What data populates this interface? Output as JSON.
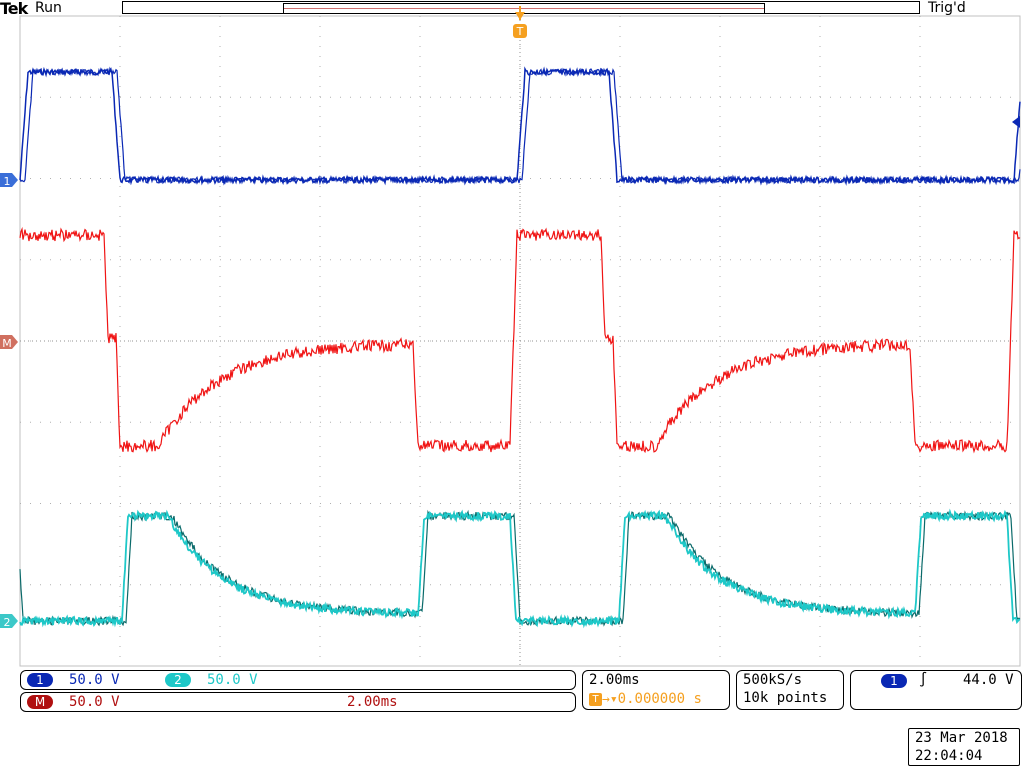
{
  "header": {
    "brand": "Tek",
    "run_state": "Run",
    "trigger_status": "Trig'd"
  },
  "markers": {
    "ch1": "1",
    "math": "M",
    "ch2": "2",
    "trigger_position": "T"
  },
  "colors": {
    "ch1": "#0a28b4",
    "math": "#f01414",
    "ch2": "#1ec8c8",
    "ch2_dark": "#0a6a6a",
    "trigger": "#f5a020",
    "math_badge": "#b01010",
    "grid": "#b0b0b0"
  },
  "channel_readout": {
    "ch1_badge": "1",
    "ch1_scale": "50.0 V",
    "ch2_badge": "2",
    "ch2_scale": "50.0 V",
    "math_badge": "M",
    "math_scale": "50.0 V",
    "math_timebase": "2.00ms"
  },
  "horizontal": {
    "timebase": "2.00ms",
    "trigger_icon": "T",
    "delay_arrow": "→▾",
    "delay": "0.000000 s"
  },
  "acquisition": {
    "sample_rate": "500kS/s",
    "record_length": "10k points"
  },
  "trigger": {
    "source_badge": "1",
    "slope_icon": "rising-edge",
    "slope_glyph": "∫",
    "level": "44.0 V"
  },
  "datetime": {
    "date": "23 Mar  2018",
    "time": "22:04:04"
  }
}
